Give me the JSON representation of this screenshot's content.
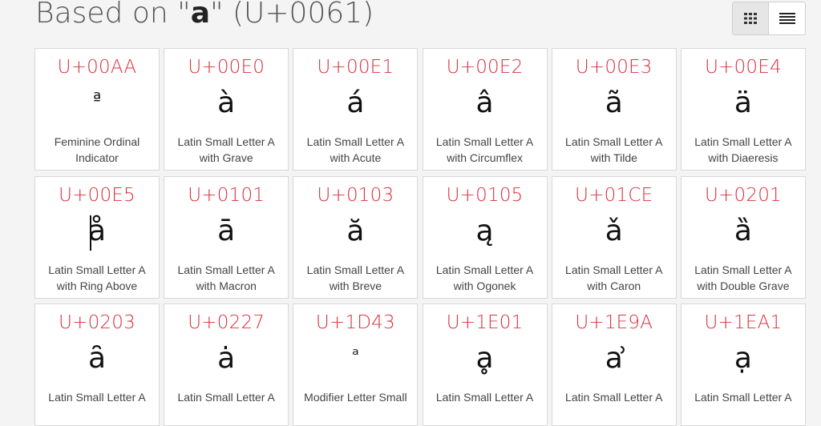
{
  "header": {
    "title_prefix": "Based on \"",
    "title_char": "a",
    "title_suffix": "\" (U+0061)"
  },
  "view_toggle": {
    "grid_icon": "grid-view-icon",
    "list_icon": "list-view-icon",
    "active": "grid"
  },
  "cards": [
    {
      "code": "U+00AA",
      "glyph": "ª",
      "name": "Feminine Ordinal Indicator"
    },
    {
      "code": "U+00E0",
      "glyph": "à",
      "name": "Latin Small Letter A with Grave"
    },
    {
      "code": "U+00E1",
      "glyph": "á",
      "name": "Latin Small Letter A with Acute"
    },
    {
      "code": "U+00E2",
      "glyph": "â",
      "name": "Latin Small Letter A with Circumflex"
    },
    {
      "code": "U+00E3",
      "glyph": "ã",
      "name": "Latin Small Letter A with Tilde"
    },
    {
      "code": "U+00E4",
      "glyph": "ä",
      "name": "Latin Small Letter A with Diaeresis"
    },
    {
      "code": "U+00E5",
      "glyph": "å",
      "name": "Latin Small Letter A with Ring Above"
    },
    {
      "code": "U+0101",
      "glyph": "ā",
      "name": "Latin Small Letter A with Macron"
    },
    {
      "code": "U+0103",
      "glyph": "ă",
      "name": "Latin Small Letter A with Breve"
    },
    {
      "code": "U+0105",
      "glyph": "ą",
      "name": "Latin Small Letter A with Ogonek"
    },
    {
      "code": "U+01CE",
      "glyph": "ǎ",
      "name": "Latin Small Letter A with Caron"
    },
    {
      "code": "U+0201",
      "glyph": "ȁ",
      "name": "Latin Small Letter A with Double Grave"
    },
    {
      "code": "U+0203",
      "glyph": "ȃ",
      "name": "Latin Small Letter A"
    },
    {
      "code": "U+0227",
      "glyph": "ȧ",
      "name": "Latin Small Letter A"
    },
    {
      "code": "U+1D43",
      "glyph": "ᵃ",
      "name": "Modifier Letter Small"
    },
    {
      "code": "U+1E01",
      "glyph": "ḁ",
      "name": "Latin Small Letter A"
    },
    {
      "code": "U+1E9A",
      "glyph": "ẚ",
      "name": "Latin Small Letter A"
    },
    {
      "code": "U+1EA1",
      "glyph": "ạ",
      "name": "Latin Small Letter A"
    }
  ]
}
